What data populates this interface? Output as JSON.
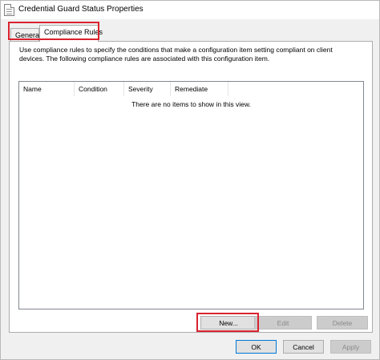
{
  "window": {
    "title": "Credential Guard Status Properties"
  },
  "tabs": [
    {
      "label": "General",
      "selected": false
    },
    {
      "label": "Compliance Rules",
      "selected": true
    }
  ],
  "panel": {
    "description": "Use compliance rules to specify the conditions that make a configuration item setting compliant on client devices. The following compliance rules are associated with this configuration item."
  },
  "list": {
    "columns": [
      "Name",
      "Condition",
      "Severity",
      "Remediate"
    ],
    "empty_message": "There are no items to show in this view."
  },
  "rule_buttons": {
    "new_label": "New...",
    "edit_label": "Edit",
    "delete_label": "Delete"
  },
  "dialog_buttons": {
    "ok_label": "OK",
    "cancel_label": "Cancel",
    "apply_label": "Apply"
  },
  "colors": {
    "highlight": "#d9232e",
    "focus_border": "#0078d7"
  },
  "icons": {
    "app_icon": "document-icon"
  }
}
